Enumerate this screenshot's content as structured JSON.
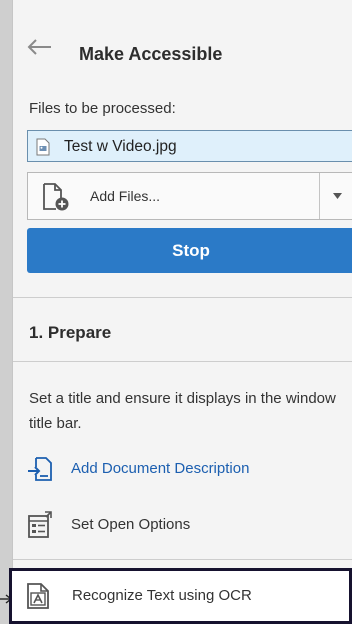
{
  "header": {
    "back_icon": "arrow-left-icon",
    "title": "Make Accessible"
  },
  "files": {
    "label": "Files to be processed:",
    "items": [
      {
        "name": "Test w Video.jpg",
        "icon": "image-file-icon"
      }
    ]
  },
  "add_files": {
    "label": "Add Files...",
    "icon": "add-document-icon",
    "dropdown_icon": "chevron-down-icon"
  },
  "stop_button": {
    "label": "Stop",
    "color": "#2b7ac7"
  },
  "section": {
    "title": "1. Prepare",
    "description": "Set a title and ensure it displays in the window title bar."
  },
  "actions": [
    {
      "label": "Add Document Description",
      "icon": "document-description-icon",
      "style": "link"
    },
    {
      "label": "Set Open Options",
      "icon": "open-options-icon",
      "style": "plain"
    },
    {
      "label": "Recognize Text using OCR",
      "icon": "ocr-text-icon",
      "style": "highlighted"
    }
  ],
  "colors": {
    "link": "#1c5fb0",
    "highlight_border": "#16122f",
    "file_selection": "#dff0fb"
  }
}
